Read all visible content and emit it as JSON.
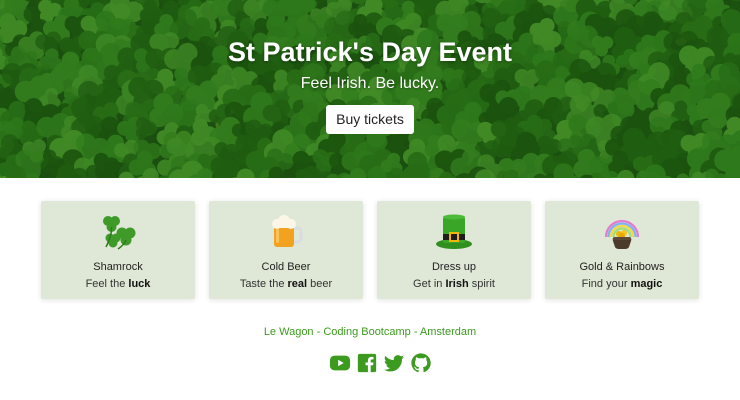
{
  "hero": {
    "title": "St Patrick's Day Event",
    "subtitle": "Feel Irish. Be lucky.",
    "button_label": "Buy tickets"
  },
  "cards": [
    {
      "icon": "shamrock-icon",
      "title": "Shamrock",
      "text_before": "Feel the ",
      "text_bold": "luck",
      "text_after": ""
    },
    {
      "icon": "beer-mug-icon",
      "title": "Cold Beer",
      "text_before": "Taste the ",
      "text_bold": "real",
      "text_after": " beer"
    },
    {
      "icon": "leprechaun-hat-icon",
      "title": "Dress up",
      "text_before": "Get in ",
      "text_bold": "Irish",
      "text_after": " spirit"
    },
    {
      "icon": "pot-of-gold-rainbow-icon",
      "title": "Gold & Rainbows",
      "text_before": "Find your ",
      "text_bold": "magic",
      "text_after": ""
    }
  ],
  "footer": {
    "text": "Le Wagon - Coding Bootcamp - Amsterdam",
    "social": [
      "youtube-icon",
      "facebook-icon",
      "twitter-icon",
      "github-icon"
    ]
  },
  "colors": {
    "accent_green": "#3c9a1e",
    "card_bg": "#dfe8d6",
    "hero_green": "#1f5a12"
  }
}
